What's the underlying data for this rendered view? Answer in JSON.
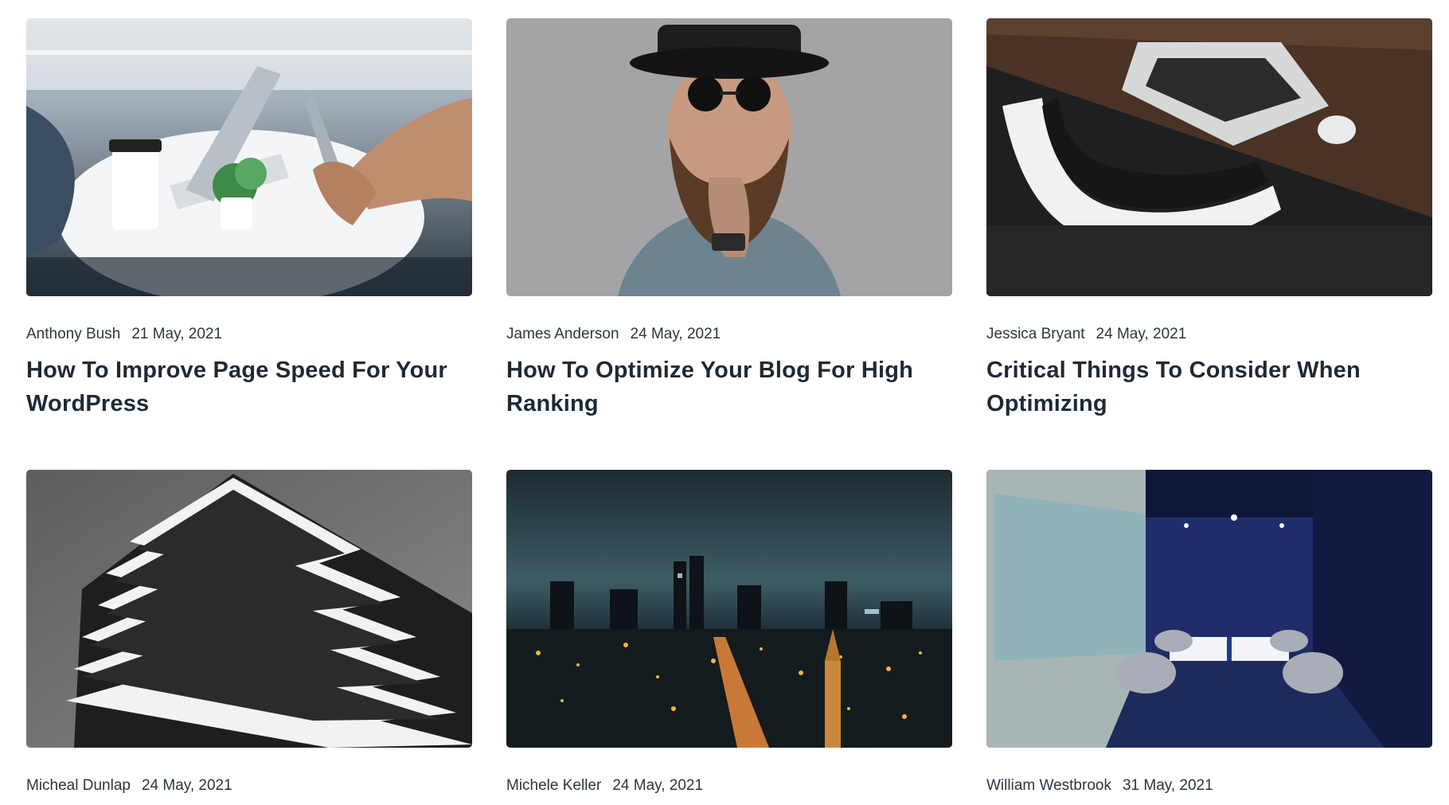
{
  "posts": [
    {
      "author": "Anthony Bush",
      "date": "21 May, 2021",
      "title": "How To Improve Page Speed For Your WordPress",
      "image": "office-laptops-coffee-photo"
    },
    {
      "author": "James Anderson",
      "date": "24 May, 2021",
      "title": "How To Optimize Your Blog For High Ranking",
      "image": "bearded-man-hat-sunglasses-photo"
    },
    {
      "author": "Jessica Bryant",
      "date": "24 May, 2021",
      "title": "Critical Things To Consider When Optimizing",
      "image": "laptop-desk-white-chair-photo"
    },
    {
      "author": "Micheal Dunlap",
      "date": "24 May, 2021",
      "title": "",
      "image": "monochrome-building-photo"
    },
    {
      "author": "Michele Keller",
      "date": "24 May, 2021",
      "title": "",
      "image": "night-city-skyline-photo"
    },
    {
      "author": "William Westbrook",
      "date": "31 May, 2021",
      "title": "",
      "image": "blue-meeting-room-photo"
    }
  ],
  "colors": {
    "text": "#1d2a36",
    "meta": "#2c3640",
    "background": "#ffffff"
  }
}
